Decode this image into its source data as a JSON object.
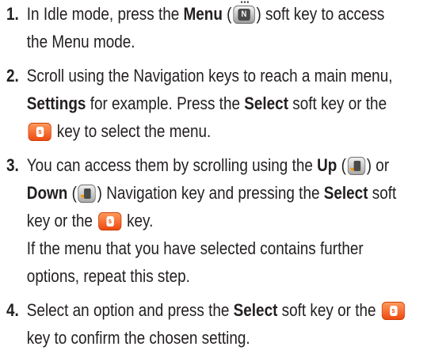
{
  "steps": [
    {
      "number": "1.",
      "l1_a": "In Idle mode, press the ",
      "l1_b": "Menu",
      "l1_c": " (",
      "l1_d": ") soft key to access",
      "l2": "the Menu mode."
    },
    {
      "number": "2.",
      "l1": "Scroll using the Navigation keys to reach a main menu,",
      "l2_a": "Settings",
      "l2_b": " for example. Press the ",
      "l2_c": "Select",
      "l2_d": " soft key or the",
      "l3": " key to select the menu."
    },
    {
      "number": "3.",
      "l1_a": "You can access them by scrolling using the ",
      "l1_b": "Up",
      "l1_c": " (",
      "l1_d": ") or",
      "l2_a": "Down",
      "l2_b": " (",
      "l2_c": ") Navigation key and pressing the ",
      "l2_d": "Select",
      "l2_e": " soft",
      "l3_a": "key or the ",
      "l3_b": " key.",
      "l4": "If the menu that you have selected contains further",
      "l5": "options, repeat this step."
    },
    {
      "number": "4.",
      "l1_a": "Select an option and press the ",
      "l1_b": "Select",
      "l1_c": " soft key or the ",
      "l2": "key to confirm the chosen setting."
    }
  ],
  "icons": {
    "menu_key": "menu-key-icon",
    "ok_key": "ok-key-icon",
    "nav_up_key": "nav-up-key-icon",
    "nav_down_key": "nav-down-key-icon",
    "menu_key_glyph": "N",
    "ok_key_glyph": "s"
  },
  "colors": {
    "text": "#231f20",
    "ok_key": "#ee4a10",
    "nav_arrow": "#f29a1c"
  }
}
